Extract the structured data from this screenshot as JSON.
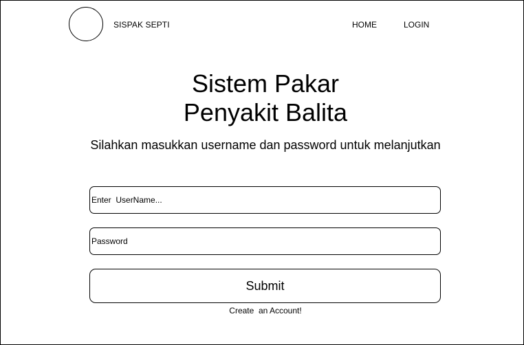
{
  "header": {
    "logo_icon": "circle-logo-icon",
    "brand": "SISPAK SEPTI",
    "nav": {
      "home": "HOME",
      "login": "LOGIN"
    }
  },
  "main": {
    "title_line1": "Sistem Pakar",
    "title_line2": "Penyakit Balita",
    "subtitle": "Silahkan masukkan username dan password untuk melanjutkan",
    "form": {
      "username_placeholder": "Enter  UserName...",
      "username_value": "",
      "password_placeholder": "Password",
      "password_value": "",
      "submit_label": "Submit",
      "create_account_label": "Create  an Account!"
    }
  },
  "colors": {
    "border": "#000000",
    "background": "#ffffff",
    "text": "#000000"
  }
}
